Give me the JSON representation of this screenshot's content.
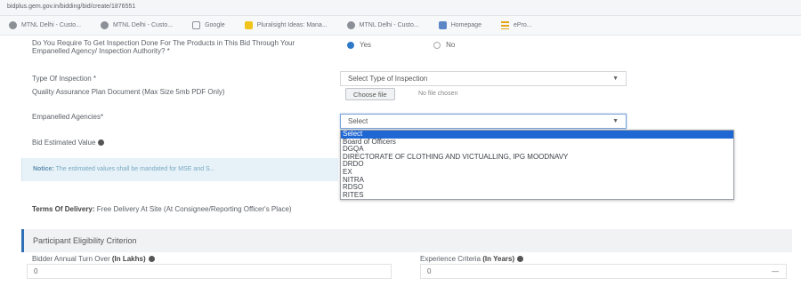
{
  "browser": {
    "url": "bidplus.gem.gov.in/bidding/bid/create/1876551",
    "bookmarks": [
      {
        "label": "MTNL Delhi - Custo...",
        "icon": "globe-icon"
      },
      {
        "label": "MTNL Delhi - Custo...",
        "icon": "globe-icon"
      },
      {
        "label": "Google",
        "icon": "google-icon"
      },
      {
        "label": "Pluralsight Ideas: Mana...",
        "icon": "bookmark-yellow-icon"
      },
      {
        "label": "MTNL Delhi - Custo...",
        "icon": "globe-icon"
      },
      {
        "label": "Homepage",
        "icon": "homepage-icon"
      },
      {
        "label": "ePro...",
        "icon": "list-icon"
      }
    ]
  },
  "form": {
    "inspection_question": "Do You Require To Get Inspection Done For The Products in This Bid Through Your Empanelled Agency/ Inspection Authority? *",
    "radio_yes": "Yes",
    "radio_no": "No",
    "type_of_inspection_label": "Type Of Inspection *",
    "type_of_inspection_value": "Select Type of Inspection",
    "qap_label": "Quality Assurance Plan Document (Max Size 5mb PDF Only)",
    "choose_file_label": "Choose file",
    "no_file_label": "No file chosen",
    "empanelled_label": "Empanelled Agencies*",
    "empanelled_value": "Select",
    "estimated_value_label": "Bid Estimated Value",
    "dropdown_options": [
      "Select",
      "Board of Officers",
      "DGQA",
      "DIRECTORATE OF CLOTHING AND VICTUALLING, IPG MOODNAVY",
      "DRDO",
      "EX",
      "NITRA",
      "RDSO",
      "RITES"
    ],
    "dropdown_selected_index": 0,
    "alert_title": "Notice:",
    "alert_text": "The estimated values shall be mandated for MSE and S...",
    "terms_label": "Terms Of Delivery:",
    "terms_value": "Free Delivery At Site (At Consignee/Reporting Officer's Place)",
    "section_title": "Participant Eligibility Criterion",
    "turnover_label": "Bidder Annual Turn Over",
    "turnover_unit": "(In Lakhs)",
    "turnover_value": "0",
    "experience_label": "Experience Criteria",
    "experience_unit": "(In Years)",
    "experience_value": "0"
  },
  "colors": {
    "accent": "#2f79c9",
    "selected_option": "#1f68d4",
    "alert_bg": "#e6f2f8",
    "section_bar": "#2f6fb5"
  }
}
